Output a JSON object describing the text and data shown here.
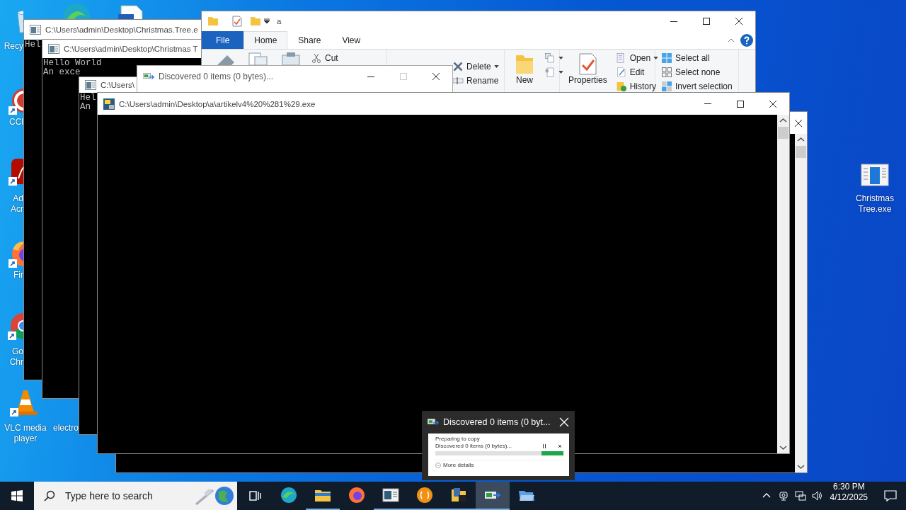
{
  "desktop_icons": [
    {
      "lines": [
        "Recy"
      ],
      "shortcut": false
    },
    {
      "shortcut": false
    },
    {
      "shortcut": false
    },
    {
      "lines": [
        "CCl"
      ],
      "shortcut": true
    },
    {
      "lines": [
        "Ad",
        "Acr"
      ],
      "shortcut": true
    },
    {
      "lines": [
        "Fir"
      ],
      "shortcut": true
    },
    {
      "lines": [
        "Go",
        "Chr"
      ],
      "shortcut": true
    },
    {
      "lines": [
        "VLC media",
        "player"
      ],
      "shortcut": true
    },
    {
      "lines": [
        "electro"
      ]
    },
    {
      "lines": [
        "Christmas",
        "Tree.exe"
      ],
      "shortcut": false
    }
  ],
  "windows": [
    {
      "kind": "console",
      "title": "C:\\Users\\admin\\Desktop\\Christmas.Tree.e",
      "lines": [
        "Hel"
      ]
    },
    {
      "kind": "console",
      "title": "C:\\Users\\admin\\Desktop\\Christmas T",
      "lines": [
        "Hello World",
        "An exce"
      ]
    },
    {
      "kind": "explorer",
      "title": "a",
      "tabs": [
        {
          "label": "File",
          "selected": false
        },
        {
          "label": "Home",
          "selected": true
        },
        {
          "label": "Share",
          "selected": false
        },
        {
          "label": "View",
          "selected": false
        }
      ],
      "groups": [
        {
          "items": [
            {
              "kind": "big"
            },
            {
              "kind": "big"
            },
            {
              "kind": "big"
            },
            {
              "kind": "small",
              "label": "Cut",
              "dropdown": false
            }
          ]
        },
        {
          "items": [
            {
              "kind": "small",
              "label": "Delete",
              "dropdown": true
            },
            {
              "kind": "small",
              "label": "Rename",
              "dropdown": false
            }
          ]
        },
        {
          "items": [
            {
              "kind": "big",
              "label": "New"
            },
            {
              "kind": "small",
              "dropdown": true
            },
            {
              "kind": "small",
              "dropdown": true
            }
          ]
        },
        {
          "items": [
            {
              "kind": "big",
              "label": "Properties"
            },
            {
              "kind": "small",
              "label": "Open",
              "dropdown": true
            },
            {
              "kind": "small",
              "label": "Edit",
              "dropdown": false
            },
            {
              "kind": "small",
              "label": "History",
              "dropdown": false
            }
          ]
        },
        {
          "items": [
            {
              "kind": "small",
              "label": "Select all",
              "dropdown": false
            },
            {
              "kind": "small",
              "label": "Select none",
              "dropdown": false
            },
            {
              "kind": "small",
              "label": "Invert selection",
              "dropdown": false
            }
          ]
        }
      ]
    },
    {
      "kind": "console",
      "title": "C:\\Users\\",
      "lines": [
        "Hel",
        "An"
      ]
    },
    {
      "kind": "console"
    },
    {
      "kind": "dialog",
      "title": "Discovered 0 items (0 bytes)..."
    },
    {
      "kind": "console",
      "title": "C:\\Users\\admin\\Desktop\\a\\artikelv4%20%281%29.exe"
    }
  ],
  "copy_preview": {
    "title": "Discovered 0 items (0 byt...",
    "status": "Preparing to copy",
    "detail": "Discovered 0 items (0 bytes)...",
    "more": "More details",
    "level": 0.17
  },
  "taskbar": {
    "search_placeholder": "Type here to search",
    "apps": [
      {
        "running": false,
        "selected": false
      },
      {
        "running": true,
        "selected": false
      },
      {
        "running": false,
        "selected": false
      },
      {
        "running": true,
        "selected": false
      },
      {
        "running": true,
        "selected": false
      },
      {
        "running": true,
        "selected": false
      },
      {
        "running": true,
        "selected": true
      },
      {
        "running": false,
        "selected": false
      }
    ],
    "time": "6:30 PM",
    "date": "4/12/2025"
  }
}
